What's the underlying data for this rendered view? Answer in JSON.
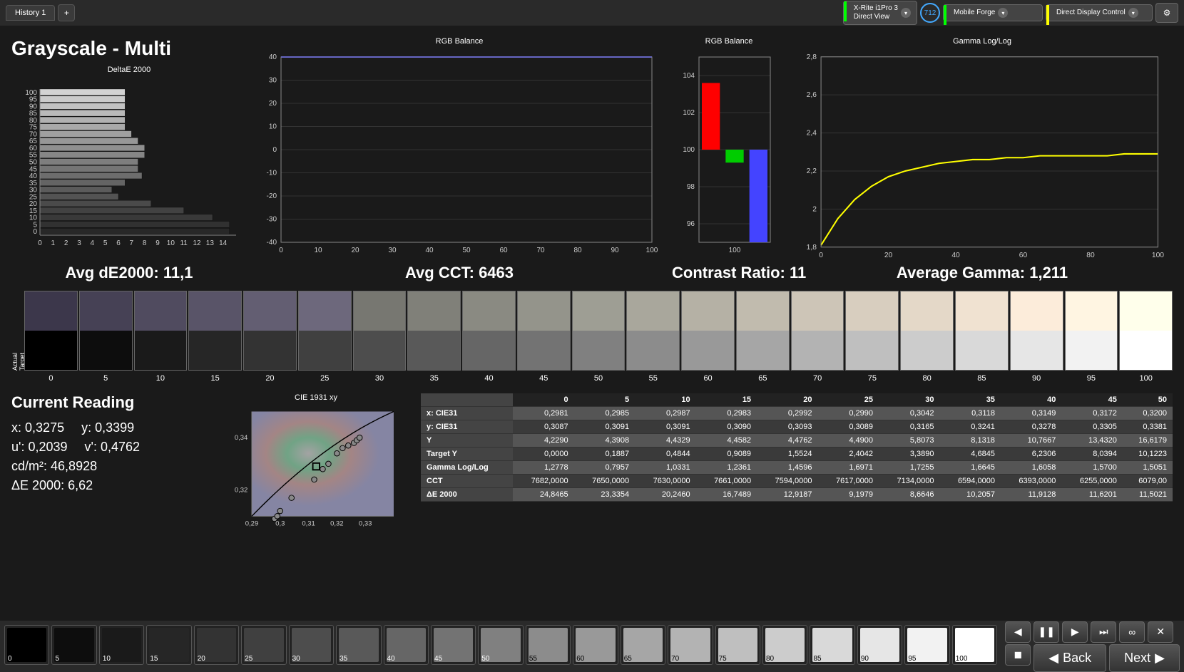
{
  "topbar": {
    "tab_label": "History 1",
    "device1": {
      "line1": "X-Rite i1Pro 3",
      "line2": "Direct View"
    },
    "badge": "712",
    "device2": "Mobile Forge",
    "device3": "Direct Display Control"
  },
  "page_title": "Grayscale - Multi",
  "charts": {
    "de2000_title": "DeltaE 2000",
    "rgb_balance_title": "RGB Balance",
    "rgb_bars_title": "RGB Balance",
    "gamma_title": "Gamma Log/Log"
  },
  "metrics": {
    "avg_de2000_label": "Avg dE2000:",
    "avg_de2000_value": "11,1",
    "avg_cct_label": "Avg CCT:",
    "avg_cct_value": "6463",
    "contrast_label": "Contrast Ratio:",
    "contrast_value": "11",
    "avg_gamma_label": "Average Gamma:",
    "avg_gamma_value": "1,211"
  },
  "swatches": {
    "actual_label": "Actual",
    "target_label": "Target",
    "levels": [
      "0",
      "5",
      "10",
      "15",
      "20",
      "25",
      "30",
      "35",
      "40",
      "45",
      "50",
      "55",
      "60",
      "65",
      "70",
      "75",
      "80",
      "85",
      "90",
      "95",
      "100"
    ]
  },
  "current_reading": {
    "title": "Current Reading",
    "x_label": "x:",
    "x_value": "0,3275",
    "y_label": "y:",
    "y_value": "0,3399",
    "up_label": "u':",
    "up_value": "0,2039",
    "vp_label": "v':",
    "vp_value": "0,4762",
    "cdm2_label": "cd/m²:",
    "cdm2_value": "46,8928",
    "de_label": "ΔE 2000:",
    "de_value": "6,62",
    "cie_title": "CIE 1931 xy"
  },
  "table": {
    "headers": [
      "",
      "0",
      "5",
      "10",
      "15",
      "20",
      "25",
      "30",
      "35",
      "40",
      "45",
      "50"
    ],
    "rows": [
      {
        "label": "x: CIE31",
        "vals": [
          "0,2981",
          "0,2985",
          "0,2987",
          "0,2983",
          "0,2992",
          "0,2990",
          "0,3042",
          "0,3118",
          "0,3149",
          "0,3172",
          "0,3200"
        ]
      },
      {
        "label": "y: CIE31",
        "vals": [
          "0,3087",
          "0,3091",
          "0,3091",
          "0,3090",
          "0,3093",
          "0,3089",
          "0,3165",
          "0,3241",
          "0,3278",
          "0,3305",
          "0,3381"
        ]
      },
      {
        "label": "Y",
        "vals": [
          "4,2290",
          "4,3908",
          "4,4329",
          "4,4582",
          "4,4762",
          "4,4900",
          "5,8073",
          "8,1318",
          "10,7667",
          "13,4320",
          "16,6179"
        ]
      },
      {
        "label": "Target Y",
        "vals": [
          "0,0000",
          "0,1887",
          "0,4844",
          "0,9089",
          "1,5524",
          "2,4042",
          "3,3890",
          "4,6845",
          "6,2306",
          "8,0394",
          "10,1223"
        ]
      },
      {
        "label": "Gamma Log/Log",
        "vals": [
          "1,2778",
          "0,7957",
          "1,0331",
          "1,2361",
          "1,4596",
          "1,6971",
          "1,7255",
          "1,6645",
          "1,6058",
          "1,5700",
          "1,5051"
        ]
      },
      {
        "label": "CCT",
        "vals": [
          "7682,0000",
          "7650,0000",
          "7630,0000",
          "7661,0000",
          "7594,0000",
          "7617,0000",
          "7134,0000",
          "6594,0000",
          "6393,0000",
          "6255,0000",
          "6079,00"
        ]
      },
      {
        "label": "ΔE 2000",
        "vals": [
          "24,8465",
          "23,3354",
          "20,2460",
          "16,7489",
          "12,9187",
          "9,1979",
          "8,6646",
          "10,2057",
          "11,9128",
          "11,6201",
          "11,5021"
        ]
      }
    ]
  },
  "thumbs": [
    "0",
    "5",
    "10",
    "15",
    "20",
    "25",
    "30",
    "35",
    "40",
    "45",
    "50",
    "55",
    "60",
    "65",
    "70",
    "75",
    "80",
    "85",
    "90",
    "95",
    "100"
  ],
  "nav": {
    "back": "Back",
    "next": "Next"
  },
  "chart_data": [
    {
      "type": "bar",
      "title": "DeltaE 2000",
      "orientation": "horizontal",
      "categories": [
        0,
        5,
        10,
        15,
        20,
        25,
        30,
        35,
        40,
        45,
        50,
        55,
        60,
        65,
        70,
        75,
        80,
        85,
        90,
        95,
        100
      ],
      "values": [
        14.5,
        14.5,
        13.2,
        11.0,
        8.5,
        6.0,
        5.5,
        6.5,
        7.8,
        7.5,
        7.5,
        8.0,
        8.0,
        7.5,
        7.0,
        6.5,
        6.5,
        6.5,
        6.5,
        6.5,
        6.5
      ],
      "xlim": [
        0,
        15
      ],
      "xlabel": "",
      "ylabel": ""
    },
    {
      "type": "line",
      "title": "RGB Balance",
      "x": [
        0,
        10,
        20,
        30,
        40,
        50,
        60,
        70,
        80,
        90,
        100
      ],
      "series": [
        {
          "name": "R",
          "color": "#f00",
          "values": [
            40,
            40,
            40,
            40,
            40,
            40,
            40,
            40,
            40,
            40,
            40
          ]
        },
        {
          "name": "G",
          "color": "#0f0",
          "values": [
            40,
            40,
            40,
            40,
            40,
            40,
            40,
            40,
            40,
            40,
            40
          ]
        },
        {
          "name": "B",
          "color": "#44f",
          "values": [
            40,
            40,
            40,
            40,
            40,
            40,
            40,
            40,
            40,
            40,
            40
          ]
        }
      ],
      "ylim": [
        -40,
        40
      ],
      "xlim": [
        0,
        100
      ]
    },
    {
      "type": "bar",
      "title": "RGB Balance",
      "categories": [
        "R",
        "G",
        "B"
      ],
      "values": [
        103.6,
        99.3,
        95.0
      ],
      "colors": [
        "#f00",
        "#0c0",
        "#44f"
      ],
      "ylim": [
        95,
        105
      ],
      "center": 100
    },
    {
      "type": "line",
      "title": "Gamma Log/Log",
      "x": [
        0,
        5,
        10,
        15,
        20,
        25,
        30,
        35,
        40,
        45,
        50,
        55,
        60,
        65,
        70,
        75,
        80,
        85,
        90,
        95,
        100
      ],
      "series": [
        {
          "name": "gamma",
          "color": "#ff0",
          "values": [
            1.81,
            1.95,
            2.05,
            2.12,
            2.17,
            2.2,
            2.22,
            2.24,
            2.25,
            2.26,
            2.26,
            2.27,
            2.27,
            2.28,
            2.28,
            2.28,
            2.28,
            2.28,
            2.29,
            2.29,
            2.29
          ]
        }
      ],
      "ylim": [
        1.8,
        2.8
      ],
      "xlim": [
        0,
        100
      ]
    },
    {
      "type": "scatter",
      "title": "CIE 1931 xy",
      "xlim": [
        0.29,
        0.34
      ],
      "ylim": [
        0.31,
        0.35
      ],
      "points": [
        {
          "x": 0.298,
          "y": 0.309
        },
        {
          "x": 0.299,
          "y": 0.31
        },
        {
          "x": 0.3,
          "y": 0.312
        },
        {
          "x": 0.304,
          "y": 0.317
        },
        {
          "x": 0.312,
          "y": 0.324
        },
        {
          "x": 0.315,
          "y": 0.328
        },
        {
          "x": 0.317,
          "y": 0.33
        },
        {
          "x": 0.32,
          "y": 0.334
        },
        {
          "x": 0.322,
          "y": 0.336
        },
        {
          "x": 0.324,
          "y": 0.337
        },
        {
          "x": 0.326,
          "y": 0.338
        },
        {
          "x": 0.327,
          "y": 0.339
        },
        {
          "x": 0.328,
          "y": 0.34
        }
      ],
      "target": {
        "x": 0.3127,
        "y": 0.329
      }
    }
  ]
}
